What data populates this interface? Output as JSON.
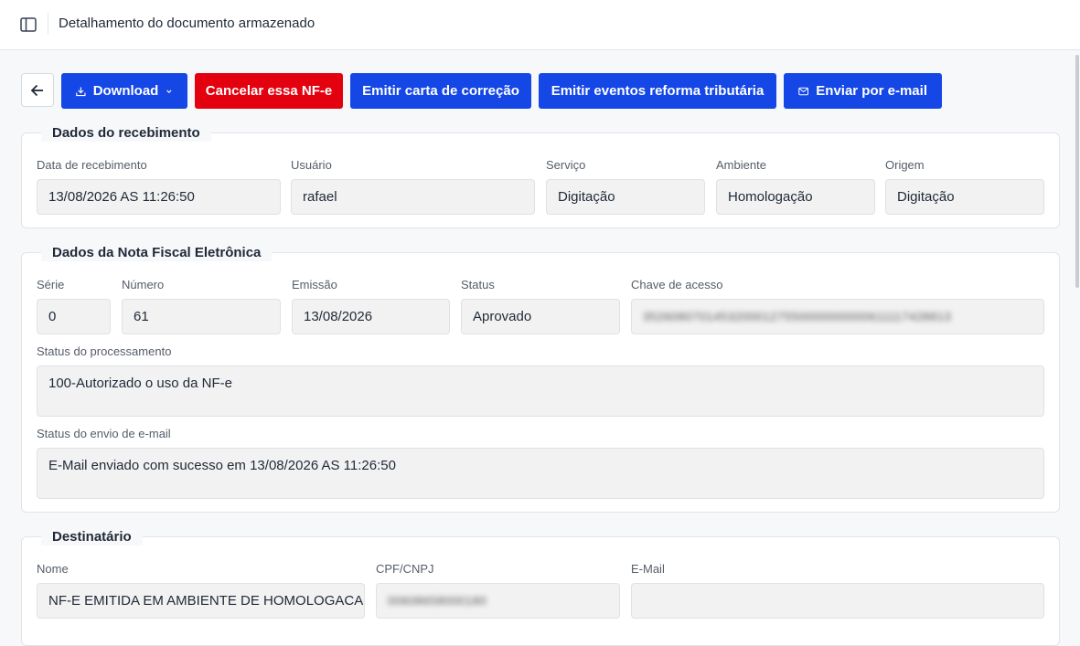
{
  "header": {
    "title": "Detalhamento do documento armazenado"
  },
  "toolbar": {
    "download_label": "Download",
    "cancel_label": "Cancelar essa NF-e",
    "correction_label": "Emitir carta de correção",
    "tax_reform_label": "Emitir eventos reforma tributária",
    "email_label": "Enviar por e-mail"
  },
  "receipt": {
    "title": "Dados do recebimento",
    "date_label": "Data de recebimento",
    "date_value": "13/08/2026 AS 11:26:50",
    "user_label": "Usuário",
    "user_value": "rafael",
    "service_label": "Serviço",
    "service_value": "Digitação",
    "environment_label": "Ambiente",
    "environment_value": "Homologação",
    "origin_label": "Origem",
    "origin_value": "Digitação"
  },
  "invoice": {
    "title": "Dados da Nota Fiscal Eletrônica",
    "series_label": "Série",
    "series_value": "0",
    "number_label": "Número",
    "number_value": "61",
    "issue_label": "Emissão",
    "issue_value": "13/08/2026",
    "status_label": "Status",
    "status_value": "Aprovado",
    "key_label": "Chave de acesso",
    "key_value": "35260807014532000127550000000000611117428813",
    "processing_label": "Status do processamento",
    "processing_value": "100-Autorizado o uso da NF-e",
    "email_status_label": "Status do envio de e-mail",
    "email_status_value": "E-Mail enviado com sucesso em 13/08/2026 AS 11:26:50"
  },
  "recipient": {
    "title": "Destinatário",
    "name_label": "Nome",
    "name_value": "NF-E EMITIDA EM AMBIENTE DE HOMOLOGACAO - SEM VALOR FISCAL",
    "doc_label": "CPF/CNPJ",
    "doc_value": "00608658000180",
    "email_label": "E-Mail",
    "email_value": ""
  }
}
